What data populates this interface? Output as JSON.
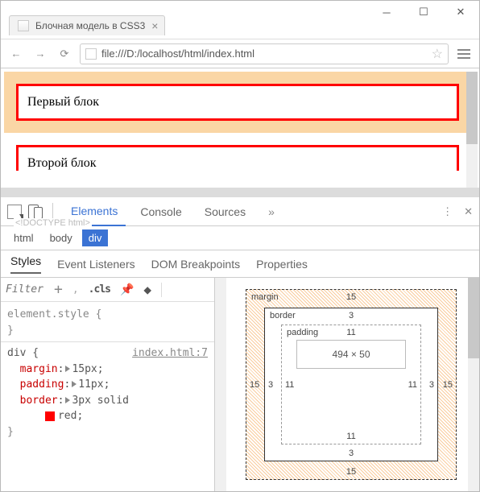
{
  "window": {
    "tab_title": "Блочная модель в CSS3",
    "url": "file:///D:/localhost/html/index.html"
  },
  "page": {
    "block1": "Первый блок",
    "block2": "Второй блок"
  },
  "devtools": {
    "tabs": {
      "elements": "Elements",
      "console": "Console",
      "sources": "Sources",
      "more": "»"
    },
    "doctype": "<!DOCTYPE html>",
    "breadcrumb": {
      "html": "html",
      "body": "body",
      "div": "div"
    },
    "subtabs": {
      "styles": "Styles",
      "eventlisteners": "Event Listeners",
      "dombreakpoints": "DOM Breakpoints",
      "properties": "Properties"
    },
    "filter": {
      "placeholder": "Filter",
      "cls": ".cls"
    },
    "rules": {
      "elementstyle": "element.style {",
      "brace_close": "}",
      "selector": "div {",
      "source": "index.html:7",
      "margin_name": "margin",
      "margin_val": "15px;",
      "padding_name": "padding",
      "padding_val": "11px;",
      "border_name": "border",
      "border_val": "3px solid",
      "border_color": "red;"
    },
    "boxmodel": {
      "margin_label": "margin",
      "margin": "15",
      "border_label": "border",
      "border": "3",
      "padding_label": "padding",
      "padding": "11",
      "content": "494 × 50"
    }
  }
}
